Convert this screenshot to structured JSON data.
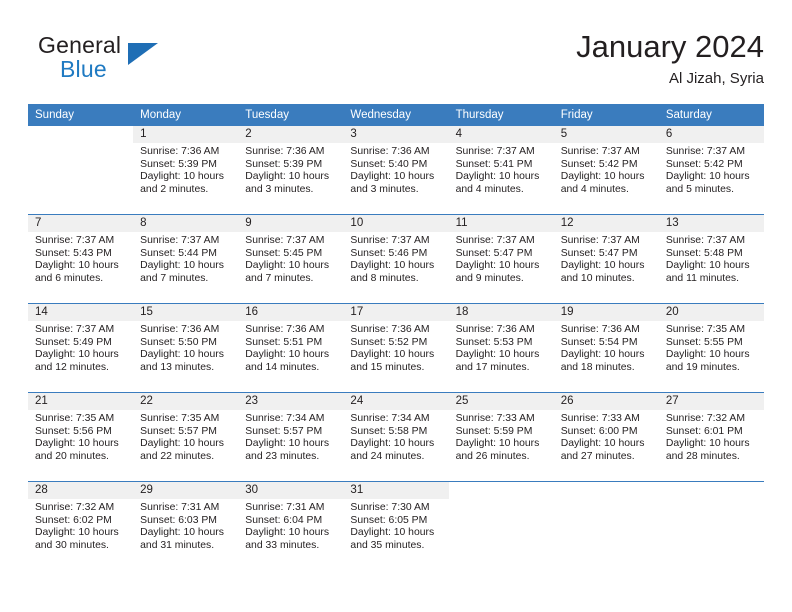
{
  "brand": {
    "name_top": "General",
    "name_bottom": "Blue",
    "accent_color": "#1f7ac2",
    "triangle_color": "#1f6eb5"
  },
  "header": {
    "title": "January 2024",
    "subtitle": "Al Jizah, Syria"
  },
  "theme": {
    "header_row_bg": "#3a7cbe",
    "daynum_bg": "#f0f0f0",
    "text_color": "#231f20"
  },
  "weekday_headers": [
    "Sunday",
    "Monday",
    "Tuesday",
    "Wednesday",
    "Thursday",
    "Friday",
    "Saturday"
  ],
  "weeks": [
    [
      {
        "day": ""
      },
      {
        "day": "1",
        "sunrise": "Sunrise: 7:36 AM",
        "sunset": "Sunset: 5:39 PM",
        "daylight_1": "Daylight: 10 hours",
        "daylight_2": "and 2 minutes."
      },
      {
        "day": "2",
        "sunrise": "Sunrise: 7:36 AM",
        "sunset": "Sunset: 5:39 PM",
        "daylight_1": "Daylight: 10 hours",
        "daylight_2": "and 3 minutes."
      },
      {
        "day": "3",
        "sunrise": "Sunrise: 7:36 AM",
        "sunset": "Sunset: 5:40 PM",
        "daylight_1": "Daylight: 10 hours",
        "daylight_2": "and 3 minutes."
      },
      {
        "day": "4",
        "sunrise": "Sunrise: 7:37 AM",
        "sunset": "Sunset: 5:41 PM",
        "daylight_1": "Daylight: 10 hours",
        "daylight_2": "and 4 minutes."
      },
      {
        "day": "5",
        "sunrise": "Sunrise: 7:37 AM",
        "sunset": "Sunset: 5:42 PM",
        "daylight_1": "Daylight: 10 hours",
        "daylight_2": "and 4 minutes."
      },
      {
        "day": "6",
        "sunrise": "Sunrise: 7:37 AM",
        "sunset": "Sunset: 5:42 PM",
        "daylight_1": "Daylight: 10 hours",
        "daylight_2": "and 5 minutes."
      }
    ],
    [
      {
        "day": "7",
        "sunrise": "Sunrise: 7:37 AM",
        "sunset": "Sunset: 5:43 PM",
        "daylight_1": "Daylight: 10 hours",
        "daylight_2": "and 6 minutes."
      },
      {
        "day": "8",
        "sunrise": "Sunrise: 7:37 AM",
        "sunset": "Sunset: 5:44 PM",
        "daylight_1": "Daylight: 10 hours",
        "daylight_2": "and 7 minutes."
      },
      {
        "day": "9",
        "sunrise": "Sunrise: 7:37 AM",
        "sunset": "Sunset: 5:45 PM",
        "daylight_1": "Daylight: 10 hours",
        "daylight_2": "and 7 minutes."
      },
      {
        "day": "10",
        "sunrise": "Sunrise: 7:37 AM",
        "sunset": "Sunset: 5:46 PM",
        "daylight_1": "Daylight: 10 hours",
        "daylight_2": "and 8 minutes."
      },
      {
        "day": "11",
        "sunrise": "Sunrise: 7:37 AM",
        "sunset": "Sunset: 5:47 PM",
        "daylight_1": "Daylight: 10 hours",
        "daylight_2": "and 9 minutes."
      },
      {
        "day": "12",
        "sunrise": "Sunrise: 7:37 AM",
        "sunset": "Sunset: 5:47 PM",
        "daylight_1": "Daylight: 10 hours",
        "daylight_2": "and 10 minutes."
      },
      {
        "day": "13",
        "sunrise": "Sunrise: 7:37 AM",
        "sunset": "Sunset: 5:48 PM",
        "daylight_1": "Daylight: 10 hours",
        "daylight_2": "and 11 minutes."
      }
    ],
    [
      {
        "day": "14",
        "sunrise": "Sunrise: 7:37 AM",
        "sunset": "Sunset: 5:49 PM",
        "daylight_1": "Daylight: 10 hours",
        "daylight_2": "and 12 minutes."
      },
      {
        "day": "15",
        "sunrise": "Sunrise: 7:36 AM",
        "sunset": "Sunset: 5:50 PM",
        "daylight_1": "Daylight: 10 hours",
        "daylight_2": "and 13 minutes."
      },
      {
        "day": "16",
        "sunrise": "Sunrise: 7:36 AM",
        "sunset": "Sunset: 5:51 PM",
        "daylight_1": "Daylight: 10 hours",
        "daylight_2": "and 14 minutes."
      },
      {
        "day": "17",
        "sunrise": "Sunrise: 7:36 AM",
        "sunset": "Sunset: 5:52 PM",
        "daylight_1": "Daylight: 10 hours",
        "daylight_2": "and 15 minutes."
      },
      {
        "day": "18",
        "sunrise": "Sunrise: 7:36 AM",
        "sunset": "Sunset: 5:53 PM",
        "daylight_1": "Daylight: 10 hours",
        "daylight_2": "and 17 minutes."
      },
      {
        "day": "19",
        "sunrise": "Sunrise: 7:36 AM",
        "sunset": "Sunset: 5:54 PM",
        "daylight_1": "Daylight: 10 hours",
        "daylight_2": "and 18 minutes."
      },
      {
        "day": "20",
        "sunrise": "Sunrise: 7:35 AM",
        "sunset": "Sunset: 5:55 PM",
        "daylight_1": "Daylight: 10 hours",
        "daylight_2": "and 19 minutes."
      }
    ],
    [
      {
        "day": "21",
        "sunrise": "Sunrise: 7:35 AM",
        "sunset": "Sunset: 5:56 PM",
        "daylight_1": "Daylight: 10 hours",
        "daylight_2": "and 20 minutes."
      },
      {
        "day": "22",
        "sunrise": "Sunrise: 7:35 AM",
        "sunset": "Sunset: 5:57 PM",
        "daylight_1": "Daylight: 10 hours",
        "daylight_2": "and 22 minutes."
      },
      {
        "day": "23",
        "sunrise": "Sunrise: 7:34 AM",
        "sunset": "Sunset: 5:57 PM",
        "daylight_1": "Daylight: 10 hours",
        "daylight_2": "and 23 minutes."
      },
      {
        "day": "24",
        "sunrise": "Sunrise: 7:34 AM",
        "sunset": "Sunset: 5:58 PM",
        "daylight_1": "Daylight: 10 hours",
        "daylight_2": "and 24 minutes."
      },
      {
        "day": "25",
        "sunrise": "Sunrise: 7:33 AM",
        "sunset": "Sunset: 5:59 PM",
        "daylight_1": "Daylight: 10 hours",
        "daylight_2": "and 26 minutes."
      },
      {
        "day": "26",
        "sunrise": "Sunrise: 7:33 AM",
        "sunset": "Sunset: 6:00 PM",
        "daylight_1": "Daylight: 10 hours",
        "daylight_2": "and 27 minutes."
      },
      {
        "day": "27",
        "sunrise": "Sunrise: 7:32 AM",
        "sunset": "Sunset: 6:01 PM",
        "daylight_1": "Daylight: 10 hours",
        "daylight_2": "and 28 minutes."
      }
    ],
    [
      {
        "day": "28",
        "sunrise": "Sunrise: 7:32 AM",
        "sunset": "Sunset: 6:02 PM",
        "daylight_1": "Daylight: 10 hours",
        "daylight_2": "and 30 minutes."
      },
      {
        "day": "29",
        "sunrise": "Sunrise: 7:31 AM",
        "sunset": "Sunset: 6:03 PM",
        "daylight_1": "Daylight: 10 hours",
        "daylight_2": "and 31 minutes."
      },
      {
        "day": "30",
        "sunrise": "Sunrise: 7:31 AM",
        "sunset": "Sunset: 6:04 PM",
        "daylight_1": "Daylight: 10 hours",
        "daylight_2": "and 33 minutes."
      },
      {
        "day": "31",
        "sunrise": "Sunrise: 7:30 AM",
        "sunset": "Sunset: 6:05 PM",
        "daylight_1": "Daylight: 10 hours",
        "daylight_2": "and 35 minutes."
      },
      {
        "day": ""
      },
      {
        "day": ""
      },
      {
        "day": ""
      }
    ]
  ]
}
